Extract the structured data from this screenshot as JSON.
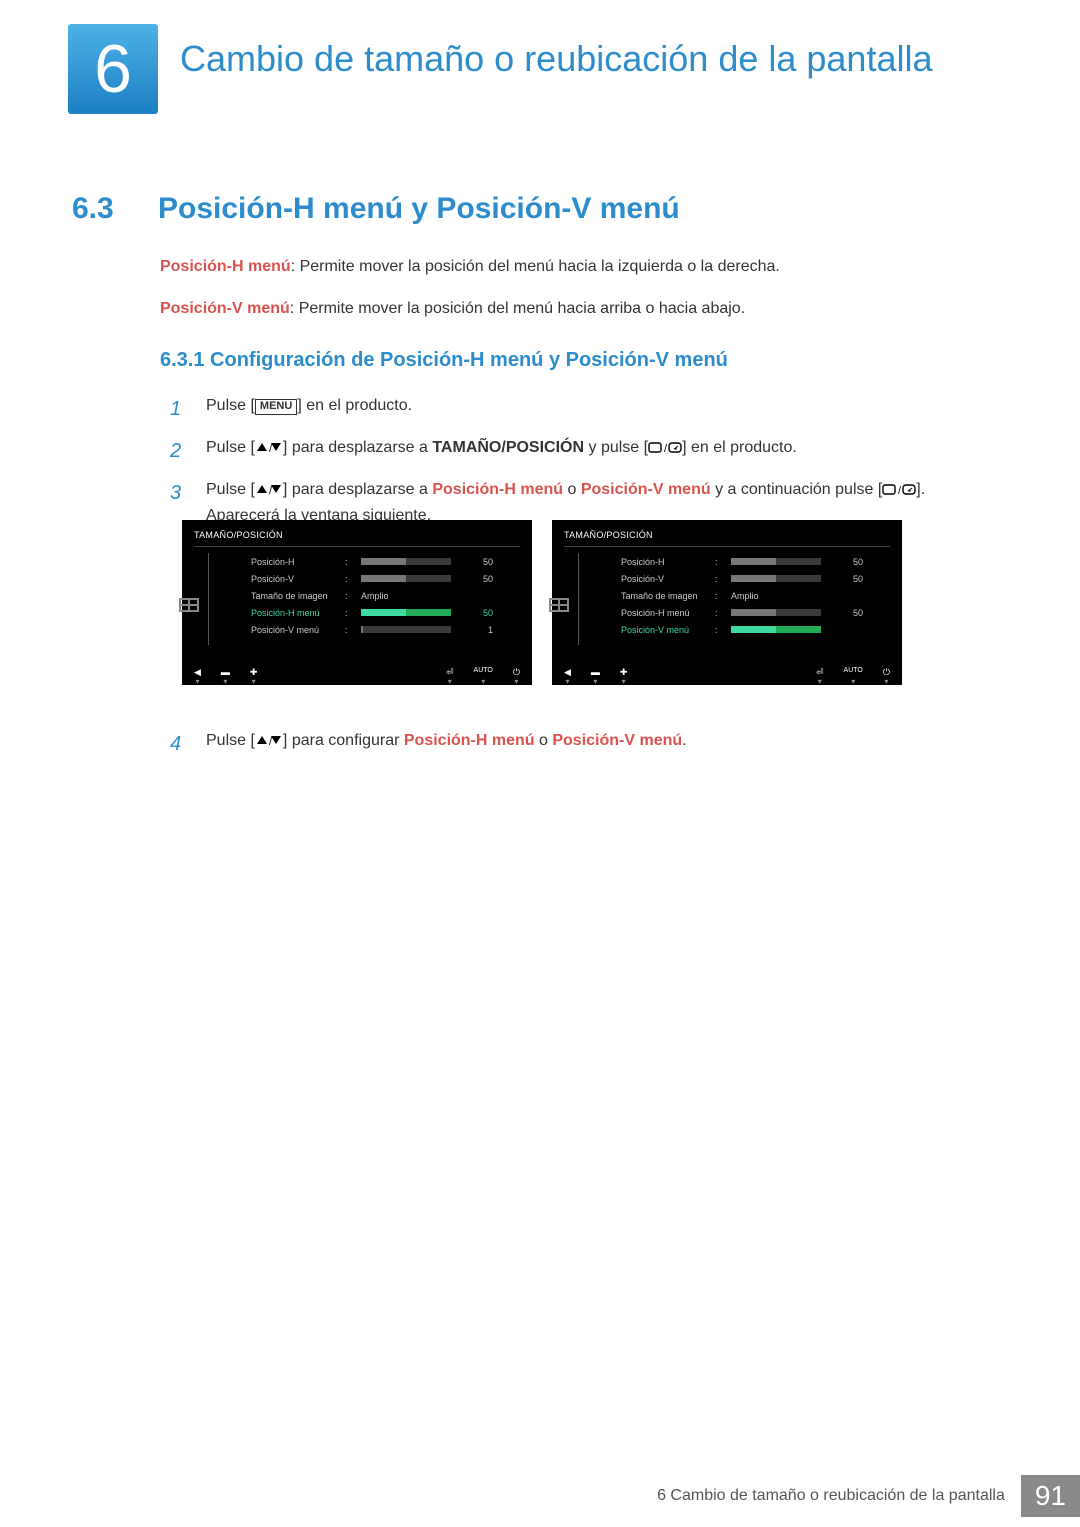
{
  "chapter": {
    "number": "6",
    "title": "Cambio de tamaño o reubicación de la pantalla"
  },
  "section": {
    "number": "6.3",
    "title": "Posición-H menú y Posición-V menú"
  },
  "intro": {
    "term1": "Posición-H menú",
    "desc1": ": Permite mover la posición del menú hacia la izquierda o la derecha.",
    "term2": "Posición-V menú",
    "desc2": ": Permite mover la posición del menú hacia arriba o hacia abajo."
  },
  "subsection": "6.3.1   Configuración de Posición-H menú y Posición-V menú",
  "steps": {
    "s1": {
      "num": "1",
      "a": "Pulse [",
      "menu": "MENU",
      "b": "] en el producto."
    },
    "s2": {
      "num": "2",
      "a": "Pulse [",
      "b": "] para desplazarse a ",
      "target": "TAMAÑO/POSICIÓN",
      "c": " y pulse [",
      "d": "] en el producto."
    },
    "s3": {
      "num": "3",
      "a": "Pulse [",
      "b": "] para desplazarse a ",
      "t1": "Posición-H menú",
      "or": " o ",
      "t2": "Posición-V menú",
      "c": " y a continuación pulse [",
      "d": "]. Aparecerá la ventana siguiente."
    },
    "s4": {
      "num": "4",
      "a": "Pulse [",
      "b": "] para configurar ",
      "t1": "Posición-H menú",
      "or": " o ",
      "t2": "Posición-V menú",
      "c": "."
    }
  },
  "panel": {
    "title": "TAMAÑO/POSICIÓN",
    "rows": {
      "pos_h": "Posición-H",
      "pos_v": "Posición-V",
      "img_size": "Tamaño de imagen",
      "amplio": "Amplio",
      "menu_h": "Posición-H menú",
      "menu_v": "Posición-V menú"
    },
    "values": {
      "fifty": "50",
      "one": "1"
    },
    "auto": "AUTO"
  },
  "footer": {
    "text": "6 Cambio de tamaño o reubicación de la pantalla",
    "page": "91"
  }
}
